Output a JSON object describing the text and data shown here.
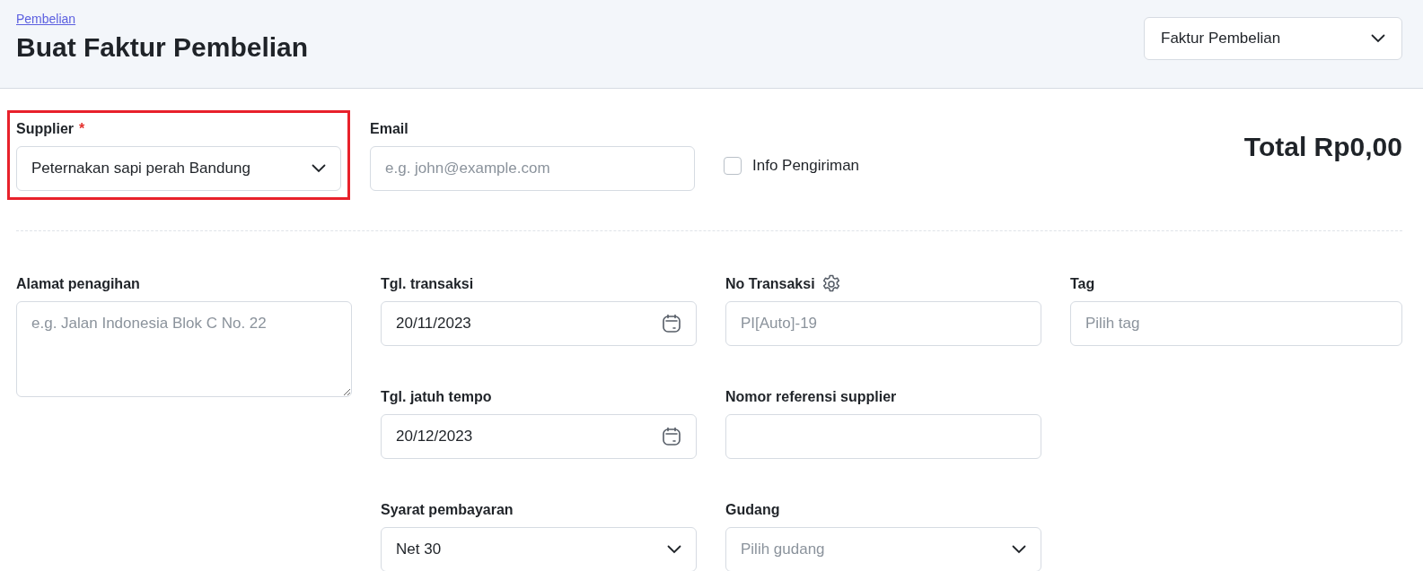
{
  "header": {
    "breadcrumb": "Pembelian",
    "title": "Buat Faktur Pembelian",
    "type_select": {
      "value": "Faktur Pembelian"
    }
  },
  "top": {
    "supplier": {
      "label": "Supplier",
      "required_mark": "*",
      "value": "Peternakan sapi perah Bandung",
      "highlighted": true
    },
    "email": {
      "label": "Email",
      "placeholder": "e.g. john@example.com"
    },
    "shipping_info": {
      "label": "Info Pengiriman",
      "checked": false
    },
    "total": "Total Rp0,00"
  },
  "columns": [
    [
      {
        "kind": "textarea",
        "label": "Alamat penagihan",
        "placeholder": "e.g. Jalan Indonesia Blok C No. 22"
      }
    ],
    [
      {
        "kind": "date",
        "label": "Tgl. transaksi",
        "value": "20/11/2023"
      },
      {
        "kind": "date",
        "label": "Tgl. jatuh tempo",
        "value": "20/12/2023"
      },
      {
        "kind": "select",
        "label": "Syarat pembayaran",
        "value": "Net 30"
      }
    ],
    [
      {
        "kind": "input",
        "label": "No Transaksi",
        "placeholder": "PI[Auto]-19",
        "settings": true
      },
      {
        "kind": "input",
        "label": "Nomor referensi supplier"
      },
      {
        "kind": "select",
        "label": "Gudang",
        "placeholder": "Pilih gudang"
      }
    ],
    [
      {
        "kind": "input",
        "label": "Tag",
        "placeholder": "Pilih tag"
      }
    ]
  ]
}
